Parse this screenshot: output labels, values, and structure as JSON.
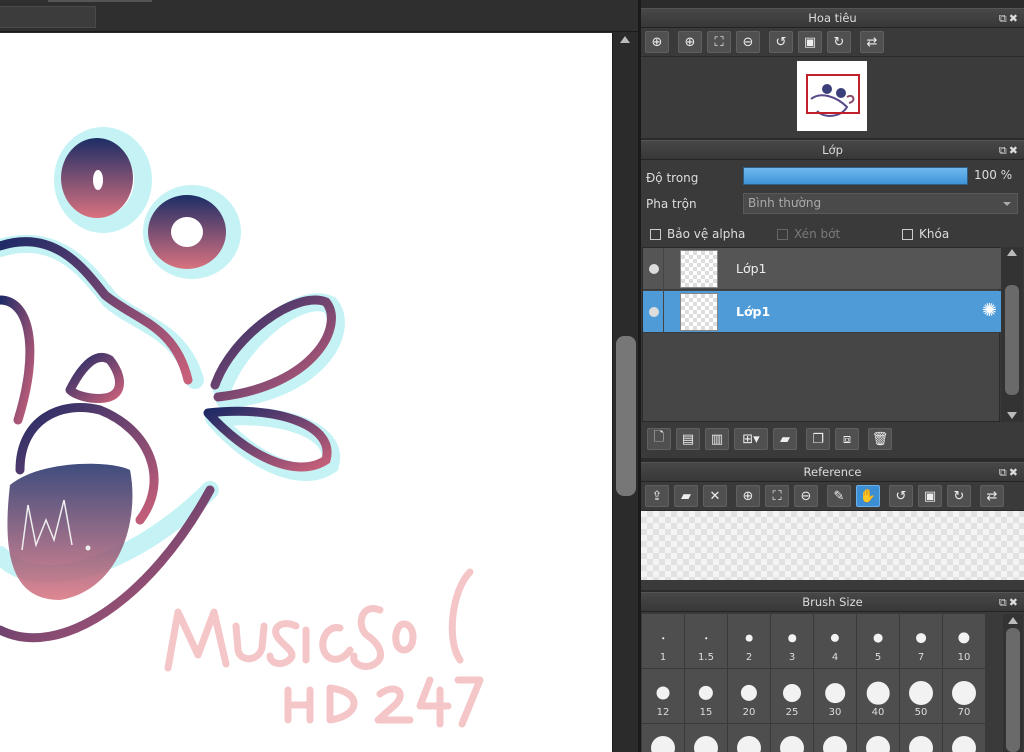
{
  "navigator": {
    "title": "Hoa tiêu",
    "tools": [
      "zoom-reset-icon",
      "zoom-in-icon",
      "fit-icon",
      "zoom-out-icon",
      "rotate-left-icon",
      "reset-rotation-icon",
      "rotate-right-icon",
      "flip-icon"
    ]
  },
  "layer": {
    "title": "Lớp",
    "opacity_label": "Độ trong",
    "opacity_value": "100 %",
    "opacity_fraction": 1.0,
    "blend_label": "Pha trộn",
    "blend_value": "Bình thường",
    "protect_alpha": "Bảo vệ alpha",
    "clipping": "Xén bớt",
    "lock": "Khóa",
    "layers": [
      {
        "name": "Lớp1",
        "selected": false
      },
      {
        "name": "Lớp1",
        "selected": true
      }
    ]
  },
  "reference": {
    "title": "Reference"
  },
  "brush": {
    "title": "Brush Size",
    "sizes": [
      "1",
      "1.5",
      "2",
      "3",
      "4",
      "5",
      "7",
      "10",
      "12",
      "15",
      "20",
      "25",
      "30",
      "40",
      "50",
      "70",
      "",
      "",
      "",
      "",
      "",
      "",
      "",
      ""
    ]
  },
  "colors": {
    "accent": "#4f9bd8",
    "panel": "#3a3a3a"
  }
}
